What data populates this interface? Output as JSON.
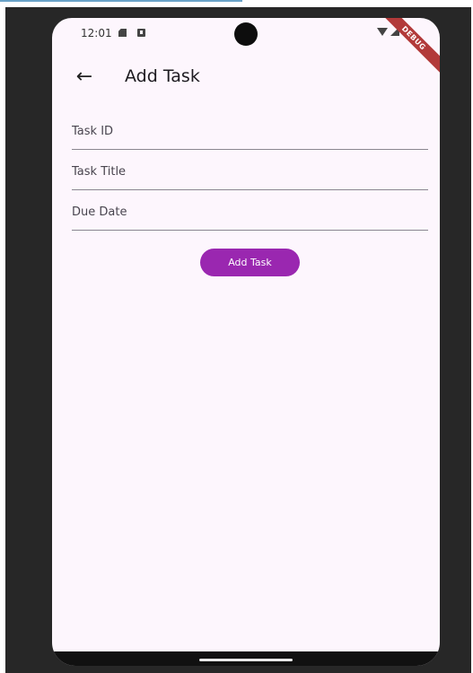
{
  "status_bar": {
    "time": "12:01",
    "icons": [
      "sd-card-icon",
      "a-icon",
      "wifi-icon",
      "signal-icon",
      "battery-icon"
    ]
  },
  "debug_banner": {
    "label": "DEBUG"
  },
  "app_bar": {
    "back_icon": "arrow-left",
    "title": "Add Task"
  },
  "form": {
    "fields": [
      {
        "placeholder": "Task ID",
        "value": ""
      },
      {
        "placeholder": "Task Title",
        "value": ""
      },
      {
        "placeholder": "Due Date",
        "value": ""
      }
    ],
    "submit_label": "Add Task"
  },
  "colors": {
    "primary": "#9a27b0",
    "background": "#fdf6fd",
    "frame": "#272727"
  }
}
